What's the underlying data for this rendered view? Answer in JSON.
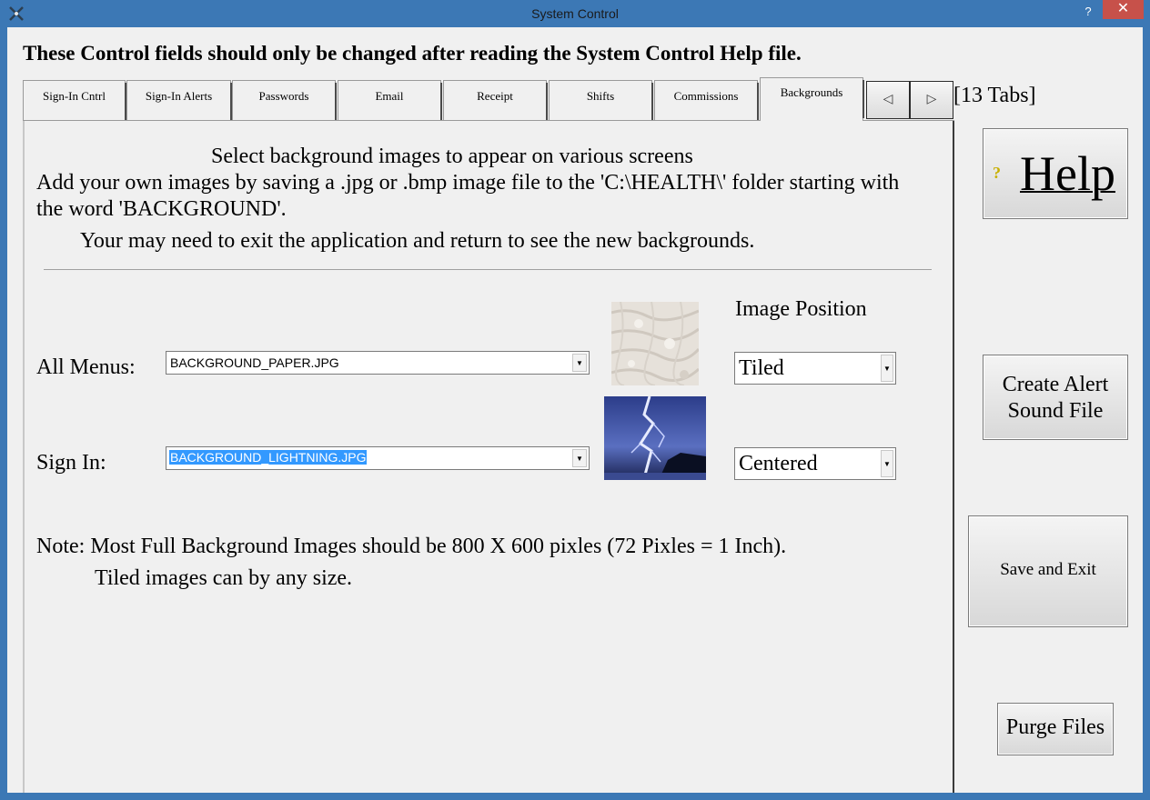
{
  "window": {
    "title": "System Control",
    "help_glyph": "?",
    "close_glyph": "✕"
  },
  "warning": "These Control fields should only be changed after reading the System Control Help file.",
  "tabs": [
    {
      "label": "Sign-In Cntrl",
      "active": false
    },
    {
      "label": "Sign-In Alerts",
      "active": false
    },
    {
      "label": "Passwords",
      "active": false
    },
    {
      "label": "Email",
      "active": false
    },
    {
      "label": "Receipt",
      "active": false
    },
    {
      "label": "Shifts",
      "active": false
    },
    {
      "label": "Commissions",
      "active": false
    },
    {
      "label": "Backgrounds",
      "active": true
    }
  ],
  "tab_scroll": {
    "left_glyph": "◁",
    "right_glyph": "▷"
  },
  "tabs_count": "[13 Tabs]",
  "intro": {
    "line1": "Select background images to appear on various screens",
    "line2": "Add your own images by saving a .jpg or .bmp image file to the 'C:\\HEALTH\\' folder starting with",
    "line3": "the word 'BACKGROUND'.",
    "line4": "Your may need to exit the application and return to see the new backgrounds."
  },
  "image_position_label": "Image Position",
  "rows": {
    "all_menus": {
      "label": "All Menus:",
      "file": "BACKGROUND_PAPER.JPG",
      "position": "Tiled",
      "thumb": "paper-texture"
    },
    "sign_in": {
      "label": "Sign In:",
      "file": "BACKGROUND_LIGHTNING.JPG",
      "position": "Centered",
      "thumb": "lightning-storm"
    }
  },
  "note": {
    "line1": "Note: Most Full Background Images should be 800 X 600 pixles (72 Pixles = 1 Inch).",
    "line2": "Tiled images can by any size."
  },
  "side_buttons": {
    "help": "Help",
    "help_icon": "?",
    "create_alert_line1": "Create Alert",
    "create_alert_line2": "Sound File",
    "save_exit": "Save and Exit",
    "purge": "Purge Files"
  },
  "colors": {
    "title_bar": "#3c78b5",
    "close_button": "#c7514a",
    "selection": "#3399ff",
    "client_bg": "#f0f0f0"
  }
}
